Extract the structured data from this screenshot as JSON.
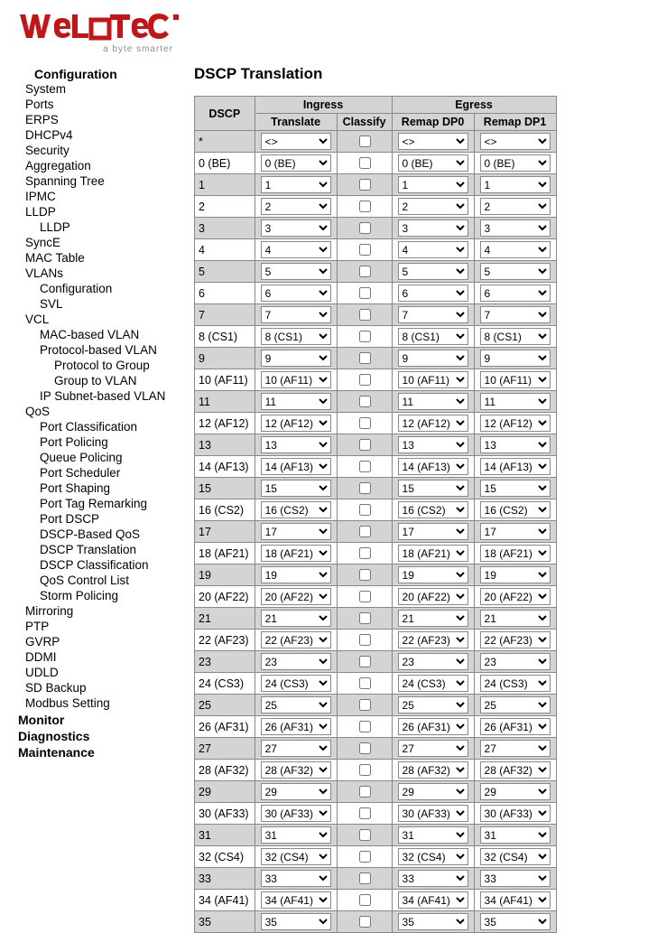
{
  "brand": {
    "name": "WeLOTEC",
    "tagline": "a byte smarter"
  },
  "colors": {
    "brandRed": "#c61414"
  },
  "nav": {
    "top_configuration": "Configuration",
    "top_monitor": "Monitor",
    "top_diagnostics": "Diagnostics",
    "top_maintenance": "Maintenance",
    "items": {
      "system": "System",
      "ports": "Ports",
      "erps": "ERPS",
      "dhcpv4": "DHCPv4",
      "security": "Security",
      "aggregation": "Aggregation",
      "spanning_tree": "Spanning Tree",
      "ipmc": "IPMC",
      "lldp": "LLDP",
      "lldp_sub": "LLDP",
      "synce": "SyncE",
      "mac_table": "MAC Table",
      "vlans": "VLANs",
      "vlans_configuration": "Configuration",
      "vlans_svl": "SVL",
      "vcl": "VCL",
      "vcl_mac": "MAC-based VLAN",
      "vcl_proto": "Protocol-based VLAN",
      "vcl_proto_ptg": "Protocol to Group",
      "vcl_proto_gtv": "Group to VLAN",
      "vcl_ipsub": "IP Subnet-based VLAN",
      "qos": "QoS",
      "qos_port_class": "Port Classification",
      "qos_port_policing": "Port Policing",
      "qos_queue_policing": "Queue Policing",
      "qos_port_scheduler": "Port Scheduler",
      "qos_port_shaping": "Port Shaping",
      "qos_port_tag_remark": "Port Tag Remarking",
      "qos_port_dscp": "Port DSCP",
      "qos_dscp_based": "DSCP-Based QoS",
      "qos_dscp_trans": "DSCP Translation",
      "qos_dscp_class": "DSCP Classification",
      "qos_qcl": "QoS Control List",
      "qos_storm": "Storm Policing",
      "mirroring": "Mirroring",
      "ptp": "PTP",
      "gvrp": "GVRP",
      "ddmi": "DDMI",
      "udld": "UDLD",
      "sdbackup": "SD Backup",
      "modbus": "Modbus Setting"
    }
  },
  "page": {
    "title": "DSCP Translation",
    "headers": {
      "dscp": "DSCP",
      "ingress": "Ingress",
      "egress": "Egress",
      "translate": "Translate",
      "classify": "Classify",
      "remap_dp0": "Remap DP0",
      "remap_dp1": "Remap DP1"
    },
    "wildcard_option": "<>",
    "rows": [
      {
        "dscp": "*",
        "translate": "<>",
        "classify": false,
        "dp0": "<>",
        "dp1": "<>"
      },
      {
        "dscp": "0 (BE)",
        "translate": "0 (BE)",
        "classify": false,
        "dp0": "0 (BE)",
        "dp1": "0 (BE)"
      },
      {
        "dscp": "1",
        "translate": "1",
        "classify": false,
        "dp0": "1",
        "dp1": "1"
      },
      {
        "dscp": "2",
        "translate": "2",
        "classify": false,
        "dp0": "2",
        "dp1": "2"
      },
      {
        "dscp": "3",
        "translate": "3",
        "classify": false,
        "dp0": "3",
        "dp1": "3"
      },
      {
        "dscp": "4",
        "translate": "4",
        "classify": false,
        "dp0": "4",
        "dp1": "4"
      },
      {
        "dscp": "5",
        "translate": "5",
        "classify": false,
        "dp0": "5",
        "dp1": "5"
      },
      {
        "dscp": "6",
        "translate": "6",
        "classify": false,
        "dp0": "6",
        "dp1": "6"
      },
      {
        "dscp": "7",
        "translate": "7",
        "classify": false,
        "dp0": "7",
        "dp1": "7"
      },
      {
        "dscp": "8 (CS1)",
        "translate": "8 (CS1)",
        "classify": false,
        "dp0": "8 (CS1)",
        "dp1": "8 (CS1)"
      },
      {
        "dscp": "9",
        "translate": "9",
        "classify": false,
        "dp0": "9",
        "dp1": "9"
      },
      {
        "dscp": "10 (AF11)",
        "translate": "10 (AF11)",
        "classify": false,
        "dp0": "10 (AF11)",
        "dp1": "10 (AF11)"
      },
      {
        "dscp": "11",
        "translate": "11",
        "classify": false,
        "dp0": "11",
        "dp1": "11"
      },
      {
        "dscp": "12 (AF12)",
        "translate": "12 (AF12)",
        "classify": false,
        "dp0": "12 (AF12)",
        "dp1": "12 (AF12)"
      },
      {
        "dscp": "13",
        "translate": "13",
        "classify": false,
        "dp0": "13",
        "dp1": "13"
      },
      {
        "dscp": "14 (AF13)",
        "translate": "14 (AF13)",
        "classify": false,
        "dp0": "14 (AF13)",
        "dp1": "14 (AF13)"
      },
      {
        "dscp": "15",
        "translate": "15",
        "classify": false,
        "dp0": "15",
        "dp1": "15"
      },
      {
        "dscp": "16 (CS2)",
        "translate": "16 (CS2)",
        "classify": false,
        "dp0": "16 (CS2)",
        "dp1": "16 (CS2)"
      },
      {
        "dscp": "17",
        "translate": "17",
        "classify": false,
        "dp0": "17",
        "dp1": "17"
      },
      {
        "dscp": "18 (AF21)",
        "translate": "18 (AF21)",
        "classify": false,
        "dp0": "18 (AF21)",
        "dp1": "18 (AF21)"
      },
      {
        "dscp": "19",
        "translate": "19",
        "classify": false,
        "dp0": "19",
        "dp1": "19"
      },
      {
        "dscp": "20 (AF22)",
        "translate": "20 (AF22)",
        "classify": false,
        "dp0": "20 (AF22)",
        "dp1": "20 (AF22)"
      },
      {
        "dscp": "21",
        "translate": "21",
        "classify": false,
        "dp0": "21",
        "dp1": "21"
      },
      {
        "dscp": "22 (AF23)",
        "translate": "22 (AF23)",
        "classify": false,
        "dp0": "22 (AF23)",
        "dp1": "22 (AF23)"
      },
      {
        "dscp": "23",
        "translate": "23",
        "classify": false,
        "dp0": "23",
        "dp1": "23"
      },
      {
        "dscp": "24 (CS3)",
        "translate": "24 (CS3)",
        "classify": false,
        "dp0": "24 (CS3)",
        "dp1": "24 (CS3)"
      },
      {
        "dscp": "25",
        "translate": "25",
        "classify": false,
        "dp0": "25",
        "dp1": "25"
      },
      {
        "dscp": "26 (AF31)",
        "translate": "26 (AF31)",
        "classify": false,
        "dp0": "26 (AF31)",
        "dp1": "26 (AF31)"
      },
      {
        "dscp": "27",
        "translate": "27",
        "classify": false,
        "dp0": "27",
        "dp1": "27"
      },
      {
        "dscp": "28 (AF32)",
        "translate": "28 (AF32)",
        "classify": false,
        "dp0": "28 (AF32)",
        "dp1": "28 (AF32)"
      },
      {
        "dscp": "29",
        "translate": "29",
        "classify": false,
        "dp0": "29",
        "dp1": "29"
      },
      {
        "dscp": "30 (AF33)",
        "translate": "30 (AF33)",
        "classify": false,
        "dp0": "30 (AF33)",
        "dp1": "30 (AF33)"
      },
      {
        "dscp": "31",
        "translate": "31",
        "classify": false,
        "dp0": "31",
        "dp1": "31"
      },
      {
        "dscp": "32 (CS4)",
        "translate": "32 (CS4)",
        "classify": false,
        "dp0": "32 (CS4)",
        "dp1": "32 (CS4)"
      },
      {
        "dscp": "33",
        "translate": "33",
        "classify": false,
        "dp0": "33",
        "dp1": "33"
      },
      {
        "dscp": "34 (AF41)",
        "translate": "34 (AF41)",
        "classify": false,
        "dp0": "34 (AF41)",
        "dp1": "34 (AF41)"
      },
      {
        "dscp": "35",
        "translate": "35",
        "classify": false,
        "dp0": "35",
        "dp1": "35"
      }
    ]
  }
}
